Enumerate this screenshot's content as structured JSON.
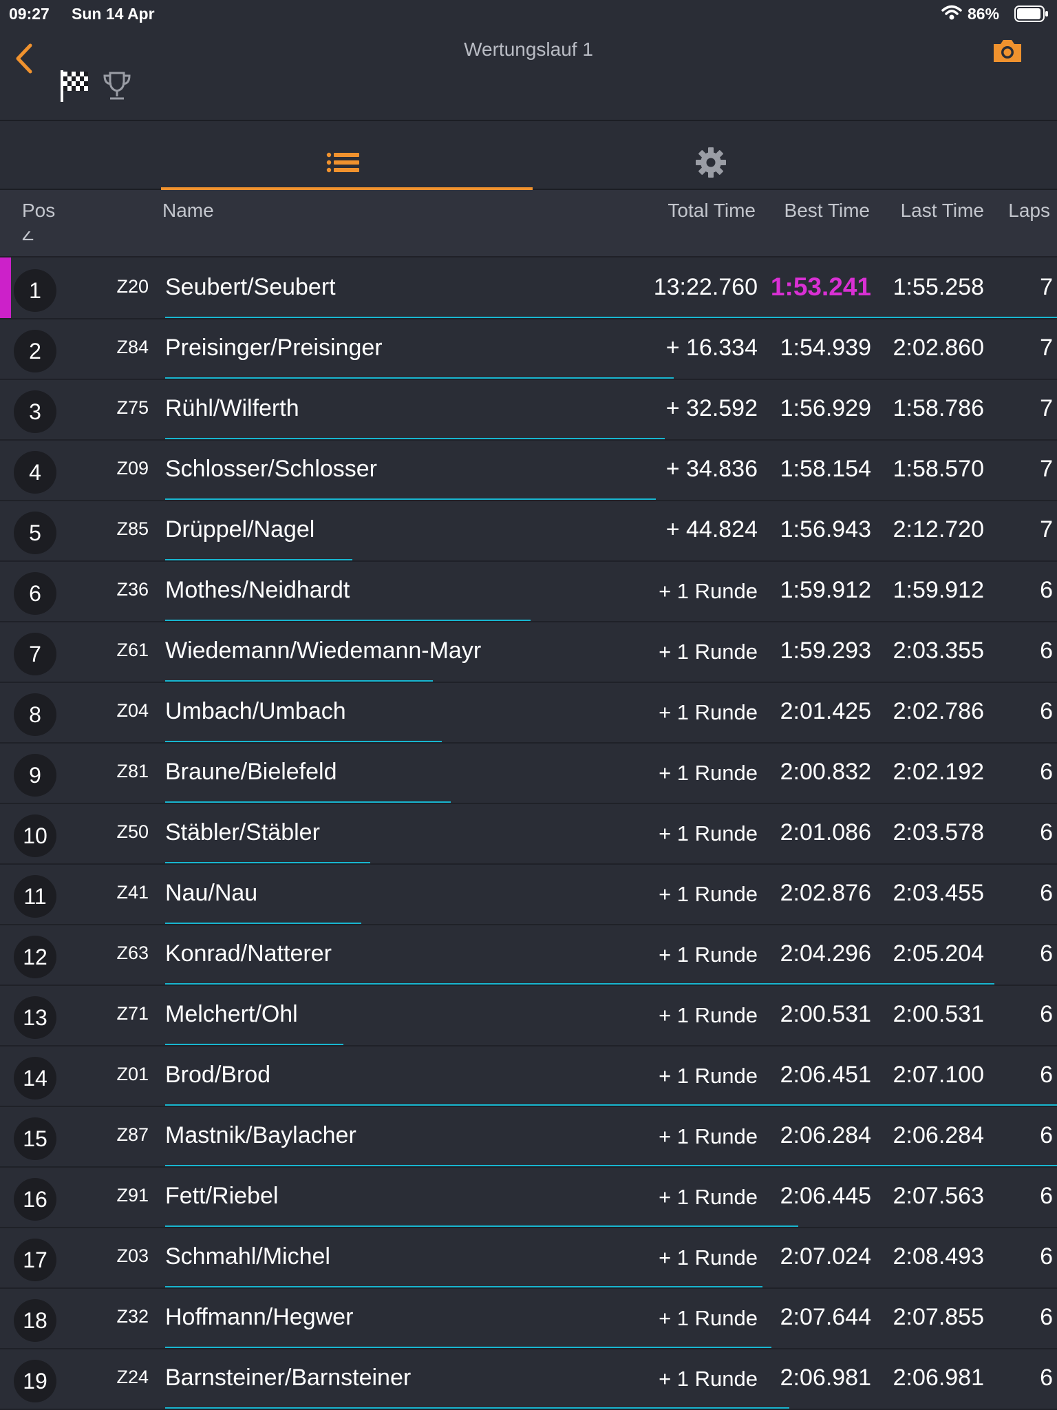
{
  "status_bar": {
    "time": "09:27",
    "date": "Sun 14 Apr",
    "battery": "86%"
  },
  "nav": {
    "title": "Wertungslauf 1",
    "accent_color": "#f0922e"
  },
  "tabs": [
    {
      "icon": "list-icon",
      "selected": true
    },
    {
      "icon": "gear-icon",
      "selected": false
    }
  ],
  "columns": {
    "pos": "Pos",
    "name": "Name",
    "total": "Total Time",
    "best": "Best Time",
    "last": "Last Time",
    "laps": "Laps"
  },
  "section_label": "Z",
  "colors": {
    "fastest_lap": "#d930d4",
    "progress_bar": "#18b6d0",
    "leader_marker": "#cc21c9"
  },
  "results": [
    {
      "pos": "1",
      "car": "Z20",
      "name": "Seubert/Seubert",
      "total": "13:22.760",
      "best": "1:53.241",
      "last": "1:55.258",
      "laps": "7",
      "progress": 1.0,
      "fastest": true
    },
    {
      "pos": "2",
      "car": "Z84",
      "name": "Preisinger/Preisinger",
      "total": "+ 16.334",
      "best": "1:54.939",
      "last": "2:02.860",
      "laps": "7",
      "progress": 0.57
    },
    {
      "pos": "3",
      "car": "Z75",
      "name": "Rühl/Wilferth",
      "total": "+ 32.592",
      "best": "1:56.929",
      "last": "1:58.786",
      "laps": "7",
      "progress": 0.56
    },
    {
      "pos": "4",
      "car": "Z09",
      "name": "Schlosser/Schlosser",
      "total": "+ 34.836",
      "best": "1:58.154",
      "last": "1:58.570",
      "laps": "7",
      "progress": 0.55
    },
    {
      "pos": "5",
      "car": "Z85",
      "name": "Drüppel/Nagel",
      "total": "+ 44.824",
      "best": "1:56.943",
      "last": "2:12.720",
      "laps": "7",
      "progress": 0.21
    },
    {
      "pos": "6",
      "car": "Z36",
      "name": "Mothes/Neidhardt",
      "total": "+ 1 Runde",
      "best": "1:59.912",
      "last": "1:59.912",
      "laps": "6",
      "progress": 0.41
    },
    {
      "pos": "7",
      "car": "Z61",
      "name": "Wiedemann/Wiedemann-Mayr",
      "total": "+ 1 Runde",
      "best": "1:59.293",
      "last": "2:03.355",
      "laps": "6",
      "progress": 0.3
    },
    {
      "pos": "8",
      "car": "Z04",
      "name": "Umbach/Umbach",
      "total": "+ 1 Runde",
      "best": "2:01.425",
      "last": "2:02.786",
      "laps": "6",
      "progress": 0.31
    },
    {
      "pos": "9",
      "car": "Z81",
      "name": "Braune/Bielefeld",
      "total": "+ 1 Runde",
      "best": "2:00.832",
      "last": "2:02.192",
      "laps": "6",
      "progress": 0.32
    },
    {
      "pos": "10",
      "car": "Z50",
      "name": "Stäbler/Stäbler",
      "total": "+ 1 Runde",
      "best": "2:01.086",
      "last": "2:03.578",
      "laps": "6",
      "progress": 0.23
    },
    {
      "pos": "11",
      "car": "Z41",
      "name": "Nau/Nau",
      "total": "+ 1 Runde",
      "best": "2:02.876",
      "last": "2:03.455",
      "laps": "6",
      "progress": 0.22
    },
    {
      "pos": "12",
      "car": "Z63",
      "name": "Konrad/Natterer",
      "total": "+ 1 Runde",
      "best": "2:04.296",
      "last": "2:05.204",
      "laps": "6",
      "progress": 0.93
    },
    {
      "pos": "13",
      "car": "Z71",
      "name": "Melchert/Ohl",
      "total": "+ 1 Runde",
      "best": "2:00.531",
      "last": "2:00.531",
      "laps": "6",
      "progress": 0.2
    },
    {
      "pos": "14",
      "car": "Z01",
      "name": "Brod/Brod",
      "total": "+ 1 Runde",
      "best": "2:06.451",
      "last": "2:07.100",
      "laps": "6",
      "progress": 1.0
    },
    {
      "pos": "15",
      "car": "Z87",
      "name": "Mastnik/Baylacher",
      "total": "+ 1 Runde",
      "best": "2:06.284",
      "last": "2:06.284",
      "laps": "6",
      "progress": 1.0
    },
    {
      "pos": "16",
      "car": "Z91",
      "name": "Fett/Riebel",
      "total": "+ 1 Runde",
      "best": "2:06.445",
      "last": "2:07.563",
      "laps": "6",
      "progress": 0.71
    },
    {
      "pos": "17",
      "car": "Z03",
      "name": "Schmahl/Michel",
      "total": "+ 1 Runde",
      "best": "2:07.024",
      "last": "2:08.493",
      "laps": "6",
      "progress": 0.67
    },
    {
      "pos": "18",
      "car": "Z32",
      "name": "Hoffmann/Hegwer",
      "total": "+ 1 Runde",
      "best": "2:07.644",
      "last": "2:07.855",
      "laps": "6",
      "progress": 0.68
    },
    {
      "pos": "19",
      "car": "Z24",
      "name": "Barnsteiner/Barnsteiner",
      "total": "+ 1 Runde",
      "best": "2:06.981",
      "last": "2:06.981",
      "laps": "6",
      "progress": 0.7
    }
  ]
}
